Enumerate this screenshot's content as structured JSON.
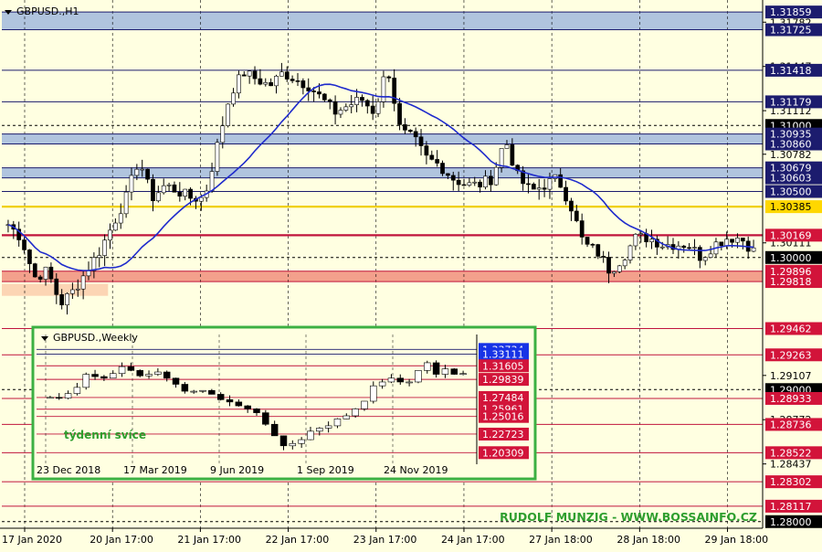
{
  "symbol_title": "GBPUSD.,H1",
  "colors": {
    "background": "#ffffe1",
    "grid": "#000000",
    "hline_blue": "#1c1c6e",
    "hline_red": "#c0143c",
    "hline_yellow": "#f0d000",
    "zone_blue": "#b0c4de",
    "zone_red": "#f3a08c",
    "zone_peach": "#fcd5b4",
    "ma": "#1f2bcc",
    "candle": "#000000",
    "inset_border": "#3cb043",
    "label_red_bg": "#d2143a",
    "label_blue_bg": "#1c1c6e",
    "label_black_bg": "#000000",
    "label_yellow_bg": "#ffd700",
    "brand_text": "#2e9e2e"
  },
  "main_chart": {
    "type": "candlestick",
    "timeframe": "H1",
    "ylim": [
      1.2795,
      1.3195
    ],
    "current_price": 1.3,
    "x_labels": [
      "17 Jan 2020",
      "20 Jan 17:00",
      "21 Jan 17:00",
      "22 Jan 17:00",
      "23 Jan 17:00",
      "24 Jan 17:00",
      "27 Jan 18:00",
      "28 Jan 18:00",
      "29 Jan 18:00"
    ],
    "price_tick_labels": [
      "1.31782",
      "1.31447",
      "1.31112",
      "1.30782",
      "1.30111",
      "1.29107",
      "1.28772",
      "1.28437"
    ],
    "levels": [
      {
        "price": 1.31859,
        "label": "1.31859",
        "style": "blue"
      },
      {
        "price": 1.31725,
        "label": "1.31725",
        "style": "blue"
      },
      {
        "price": 1.31418,
        "label": "1.31418",
        "style": "blue"
      },
      {
        "price": 1.31179,
        "label": "1.31179",
        "style": "blue"
      },
      {
        "price": 1.31,
        "label": "1.31000",
        "style": "black"
      },
      {
        "price": 1.30935,
        "label": "1.30935",
        "style": "blue"
      },
      {
        "price": 1.3086,
        "label": "1.30860",
        "style": "blue"
      },
      {
        "price": 1.30679,
        "label": "1.30679",
        "style": "blue"
      },
      {
        "price": 1.30603,
        "label": "1.30603",
        "style": "blue"
      },
      {
        "price": 1.305,
        "label": "1.30500",
        "style": "blue"
      },
      {
        "price": 1.30385,
        "label": "1.30385",
        "style": "yellow"
      },
      {
        "price": 1.30169,
        "label": "1.30169",
        "style": "red"
      },
      {
        "price": 1.3,
        "label": "1.30000",
        "style": "black"
      },
      {
        "price": 1.29896,
        "label": "1.29896",
        "style": "red"
      },
      {
        "price": 1.29818,
        "label": "1.29818",
        "style": "red"
      },
      {
        "price": 1.29462,
        "label": "1.29462",
        "style": "red"
      },
      {
        "price": 1.29263,
        "label": "1.29263",
        "style": "red"
      },
      {
        "price": 1.29,
        "label": "1.29000",
        "style": "black"
      },
      {
        "price": 1.28933,
        "label": "1.28933",
        "style": "red"
      },
      {
        "price": 1.28736,
        "label": "1.28736",
        "style": "red"
      },
      {
        "price": 1.28522,
        "label": "1.28522",
        "style": "red"
      },
      {
        "price": 1.28302,
        "label": "1.28302",
        "style": "red"
      },
      {
        "price": 1.28117,
        "label": "1.28117",
        "style": "red"
      },
      {
        "price": 1.28,
        "label": "1.28000",
        "style": "black"
      }
    ],
    "zones": [
      {
        "from": 1.31725,
        "to": 1.31859,
        "style": "blue"
      },
      {
        "from": 1.3086,
        "to": 1.30935,
        "style": "blue"
      },
      {
        "from": 1.30603,
        "to": 1.30679,
        "style": "blue"
      },
      {
        "from": 1.29818,
        "to": 1.29896,
        "style": "red"
      },
      {
        "from_date": "17 Jan 2020",
        "to_date": "20 Jan 17:00",
        "from": 1.2971,
        "to": 1.298,
        "style": "peach"
      }
    ],
    "close_path": [
      1.3025,
      1.3015,
      1.2985,
      1.299,
      1.2965,
      1.2975,
      1.299,
      1.3005,
      1.3025,
      1.3045,
      1.3075,
      1.3045,
      1.3055,
      1.305,
      1.3045,
      1.3045,
      1.3085,
      1.3125,
      1.314,
      1.3135,
      1.313,
      1.314,
      1.3135,
      1.313,
      1.312,
      1.311,
      1.3115,
      1.312,
      1.311,
      1.3145,
      1.3095,
      1.309,
      1.3075,
      1.307,
      1.306,
      1.3055,
      1.3055,
      1.306,
      1.309,
      1.306,
      1.305,
      1.3055,
      1.306,
      1.304,
      1.301,
      1.3005,
      1.299,
      1.3,
      1.3015,
      1.3015,
      1.301,
      1.301,
      1.301,
      1.3,
      1.301,
      1.3015,
      1.3015,
      1.3005
    ]
  },
  "inset": {
    "title": "GBPUSD.,Weekly",
    "caption": "týdenní svíce",
    "ylim": [
      1.1975,
      1.3425
    ],
    "x_labels": [
      "23 Dec 2018",
      "17 Mar 2019",
      "9 Jun 2019",
      "1 Sep 2019",
      "24 Nov 2019"
    ],
    "levels": [
      {
        "price": 1.33734,
        "label": "1.33734",
        "style": "blue"
      },
      {
        "price": 1.33111,
        "label": "1.33111",
        "style": "blue"
      },
      {
        "price": 1.31605,
        "label": "1.31605",
        "style": "red"
      },
      {
        "price": 1.29839,
        "label": "1.29839",
        "style": "red"
      },
      {
        "price": 1.27484,
        "label": "1.27484",
        "style": "red"
      },
      {
        "price": 1.25961,
        "label": "1.25961",
        "style": "red"
      },
      {
        "price": 1.25016,
        "label": "1.25016",
        "style": "red"
      },
      {
        "price": 1.22723,
        "label": "1.22723",
        "style": "red"
      },
      {
        "price": 1.20309,
        "label": "1.20309",
        "style": "red"
      }
    ],
    "close_path": [
      1.275,
      1.274,
      1.28,
      1.288,
      1.305,
      1.302,
      1.3,
      1.306,
      1.315,
      1.31,
      1.303,
      1.305,
      1.308,
      1.3,
      1.292,
      1.283,
      1.283,
      1.284,
      1.279,
      1.272,
      1.269,
      1.264,
      1.26,
      1.255,
      1.24,
      1.225,
      1.212,
      1.215,
      1.22,
      1.231,
      1.235,
      1.238,
      1.247,
      1.251,
      1.26,
      1.27,
      1.29,
      1.295,
      1.3,
      1.295,
      1.295,
      1.31,
      1.32,
      1.305,
      1.312,
      1.305,
      1.306
    ]
  },
  "footer_text": "RUDOLF MUNZIG - WWW.BOSSAINFO.CZ"
}
